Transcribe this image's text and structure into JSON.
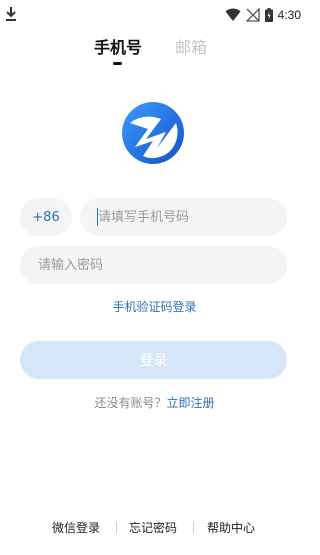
{
  "status_bar": {
    "time": "4:30"
  },
  "tabs": [
    {
      "label": "手机号",
      "active": true
    },
    {
      "label": "邮箱",
      "active": false
    }
  ],
  "form": {
    "country_code": "+86",
    "phone_placeholder": "请填写手机号码",
    "password_placeholder": "请输入密码",
    "sms_login_link": "手机验证码登录",
    "login_button": "登录"
  },
  "register": {
    "question": "还没有账号？",
    "link": "立即注册"
  },
  "bottom_links": {
    "wechat": "微信登录",
    "forgot": "忘记密码",
    "help": "帮助中心"
  },
  "colors": {
    "accent": "#2f6fb6",
    "login_button_disabled": "#d6e6f9",
    "logo_blue": "#1e6fe0"
  }
}
